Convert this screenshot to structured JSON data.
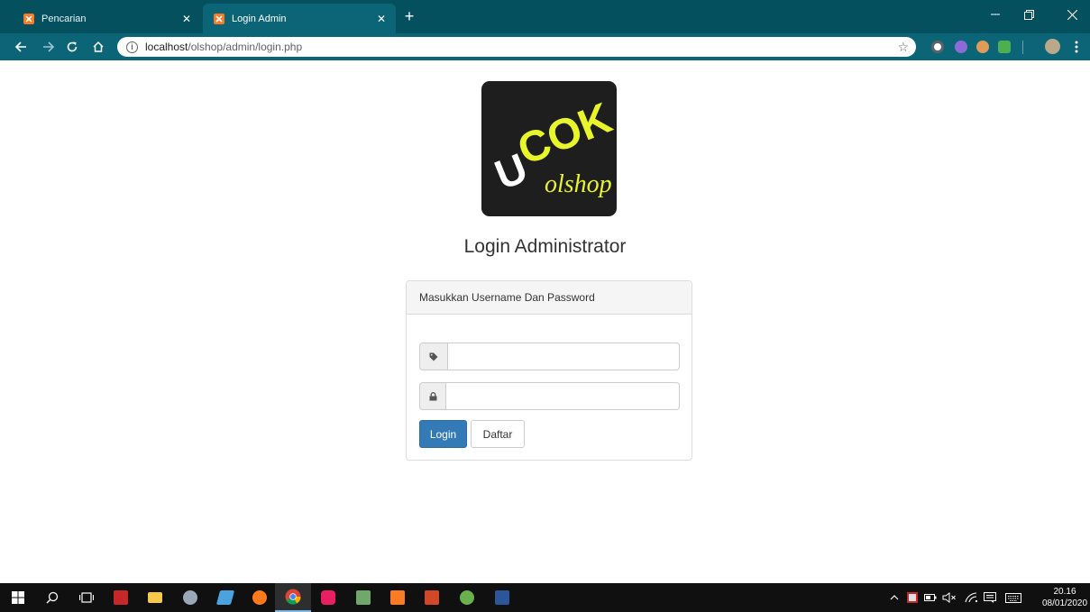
{
  "browser": {
    "tabs": [
      {
        "label": "Pencarian",
        "active": false
      },
      {
        "label": "Login Admin",
        "active": true
      }
    ],
    "new_tab": "+",
    "url_host": "localhost",
    "url_path": "/olshop/admin/login.php",
    "colors": {
      "tabbar": "#04505f",
      "toolbar": "#0b6577"
    }
  },
  "logo": {
    "text_main": "UCOK",
    "text_sub": "olshop",
    "colors": {
      "background": "#1e1e1e",
      "u": "#ffffff",
      "cok": "#e8f52a"
    }
  },
  "page": {
    "title": "Login Administrator"
  },
  "panel": {
    "heading": "Masukkan Username Dan Password",
    "username": {
      "value": "",
      "placeholder": "",
      "icon": "tag-icon"
    },
    "password": {
      "value": "",
      "placeholder": "",
      "icon": "lock-icon"
    },
    "login_label": "Login",
    "daftar_label": "Daftar",
    "colors": {
      "primary": "#337ab7"
    }
  },
  "taskbar": {
    "time": "20.16",
    "date": "08/01/2020"
  }
}
